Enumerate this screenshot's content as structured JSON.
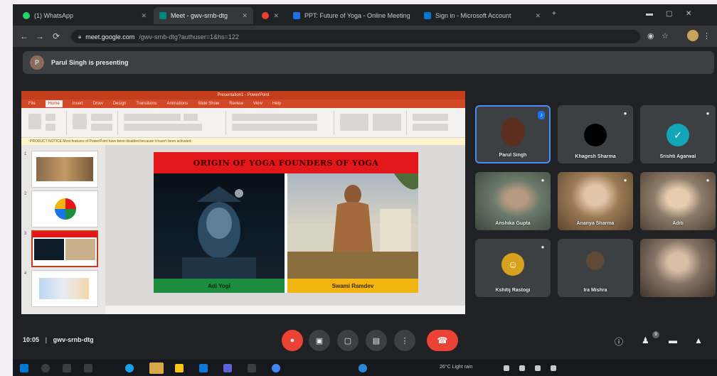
{
  "browser": {
    "tabs": [
      {
        "label": "(1) WhatsApp",
        "favicon_color": "#25d366"
      },
      {
        "label": "Meet - gwv-srnb-dtg",
        "favicon_color": "#00897b"
      },
      {
        "label": "",
        "favicon_color": "#ea4335"
      },
      {
        "label": "PPT: Future of Yoga - Online Meeting",
        "favicon_color": "#1a73e8"
      },
      {
        "label": "Sign in - Microsoft Account",
        "favicon_color": "#0078d4"
      }
    ],
    "url_host": "meet.google.com",
    "url_path": "/gwv-srnb-dtg?authuser=1&hs=122",
    "new_tab_glyph": "+"
  },
  "presenting": {
    "initial": "P",
    "text": "Parul Singh is presenting"
  },
  "powerpoint": {
    "window_title": "Presentation1 - PowerPoint",
    "ribbon_tabs": [
      "File",
      "Home",
      "Insert",
      "Draw",
      "Design",
      "Transitions",
      "Animations",
      "Slide Show",
      "Review",
      "View",
      "Help"
    ],
    "notice": "PRODUCT NOTICE  Most features of PowerPoint have been disabled because it hasn't been activated.",
    "thumbnail_numbers": [
      "1",
      "2",
      "3",
      "4"
    ]
  },
  "slide": {
    "title": "ORIGIN OF YOGA    FOUNDERS OF YOGA",
    "left_caption": "Adi Yogi",
    "right_caption": "Swami Ramdev"
  },
  "participants": [
    {
      "name": "Parul Singh",
      "initial": "",
      "type": "avatar",
      "color": "#5b2e1e",
      "mic": "♪"
    },
    {
      "name": "Khagesh Sharma",
      "initial": "",
      "type": "avatar",
      "color": "#000000",
      "mic": "●"
    },
    {
      "name": "Srishti Agarwal",
      "initial": "",
      "type": "avatar",
      "color": "#12a6b8",
      "mic": "●"
    },
    {
      "name": "Anshika Gupta",
      "initial": "",
      "type": "video",
      "color": "#6b7a6a",
      "mic": "●"
    },
    {
      "name": "Ananya Sharma",
      "initial": "",
      "type": "video",
      "color": "#9c7b55",
      "mic": "●"
    },
    {
      "name": "Aditi",
      "initial": "",
      "type": "video",
      "color": "#8e7c6a",
      "mic": "●"
    },
    {
      "name": "Kshitij Rastogi",
      "initial": "",
      "type": "avatar",
      "color": "#d8a21e",
      "mic": "●"
    },
    {
      "name": "Ira Mishra",
      "initial": "",
      "type": "avatar",
      "color": "#5e4a36",
      "mic": ""
    },
    {
      "name": "",
      "initial": "",
      "type": "video",
      "color": "#857264",
      "mic": ""
    }
  ],
  "meeting": {
    "time": "10:05",
    "separator": "|",
    "code": "gwv-srnb-dtg"
  },
  "controls": {
    "mic_glyph": "●",
    "cam_glyph": "▣",
    "cc_glyph": "▢",
    "present_glyph": "▤",
    "more_glyph": "⋮",
    "hangup_glyph": "☎",
    "info_glyph": "ⓘ",
    "people_glyph": "♟",
    "people_count": "9",
    "chat_glyph": "▬",
    "activities_glyph": "▲"
  },
  "taskbar": {
    "tray_text": "26°C Light rain"
  }
}
